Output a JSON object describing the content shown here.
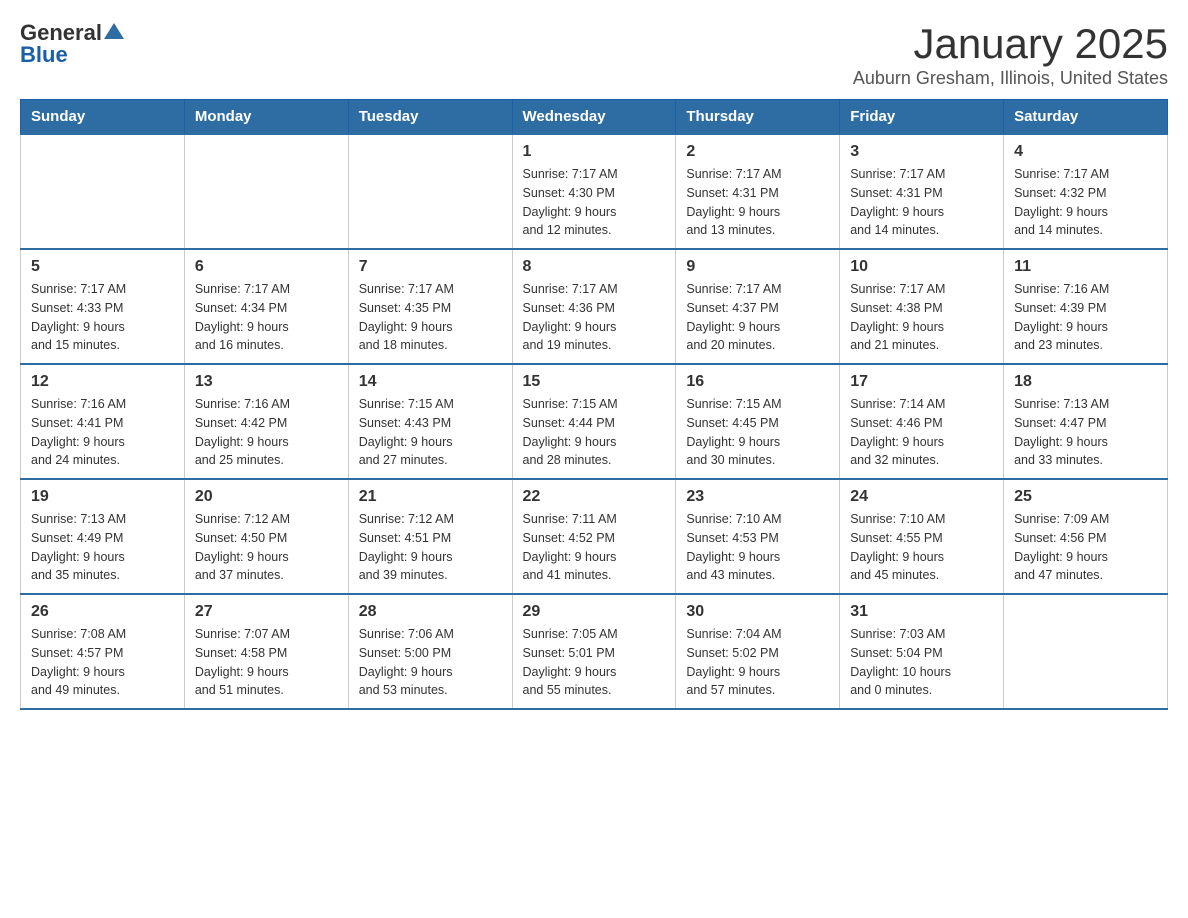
{
  "header": {
    "logo_general": "General",
    "logo_blue": "Blue",
    "month_title": "January 2025",
    "location": "Auburn Gresham, Illinois, United States"
  },
  "days_of_week": [
    "Sunday",
    "Monday",
    "Tuesday",
    "Wednesday",
    "Thursday",
    "Friday",
    "Saturday"
  ],
  "weeks": [
    [
      {
        "day": "",
        "info": ""
      },
      {
        "day": "",
        "info": ""
      },
      {
        "day": "",
        "info": ""
      },
      {
        "day": "1",
        "info": "Sunrise: 7:17 AM\nSunset: 4:30 PM\nDaylight: 9 hours\nand 12 minutes."
      },
      {
        "day": "2",
        "info": "Sunrise: 7:17 AM\nSunset: 4:31 PM\nDaylight: 9 hours\nand 13 minutes."
      },
      {
        "day": "3",
        "info": "Sunrise: 7:17 AM\nSunset: 4:31 PM\nDaylight: 9 hours\nand 14 minutes."
      },
      {
        "day": "4",
        "info": "Sunrise: 7:17 AM\nSunset: 4:32 PM\nDaylight: 9 hours\nand 14 minutes."
      }
    ],
    [
      {
        "day": "5",
        "info": "Sunrise: 7:17 AM\nSunset: 4:33 PM\nDaylight: 9 hours\nand 15 minutes."
      },
      {
        "day": "6",
        "info": "Sunrise: 7:17 AM\nSunset: 4:34 PM\nDaylight: 9 hours\nand 16 minutes."
      },
      {
        "day": "7",
        "info": "Sunrise: 7:17 AM\nSunset: 4:35 PM\nDaylight: 9 hours\nand 18 minutes."
      },
      {
        "day": "8",
        "info": "Sunrise: 7:17 AM\nSunset: 4:36 PM\nDaylight: 9 hours\nand 19 minutes."
      },
      {
        "day": "9",
        "info": "Sunrise: 7:17 AM\nSunset: 4:37 PM\nDaylight: 9 hours\nand 20 minutes."
      },
      {
        "day": "10",
        "info": "Sunrise: 7:17 AM\nSunset: 4:38 PM\nDaylight: 9 hours\nand 21 minutes."
      },
      {
        "day": "11",
        "info": "Sunrise: 7:16 AM\nSunset: 4:39 PM\nDaylight: 9 hours\nand 23 minutes."
      }
    ],
    [
      {
        "day": "12",
        "info": "Sunrise: 7:16 AM\nSunset: 4:41 PM\nDaylight: 9 hours\nand 24 minutes."
      },
      {
        "day": "13",
        "info": "Sunrise: 7:16 AM\nSunset: 4:42 PM\nDaylight: 9 hours\nand 25 minutes."
      },
      {
        "day": "14",
        "info": "Sunrise: 7:15 AM\nSunset: 4:43 PM\nDaylight: 9 hours\nand 27 minutes."
      },
      {
        "day": "15",
        "info": "Sunrise: 7:15 AM\nSunset: 4:44 PM\nDaylight: 9 hours\nand 28 minutes."
      },
      {
        "day": "16",
        "info": "Sunrise: 7:15 AM\nSunset: 4:45 PM\nDaylight: 9 hours\nand 30 minutes."
      },
      {
        "day": "17",
        "info": "Sunrise: 7:14 AM\nSunset: 4:46 PM\nDaylight: 9 hours\nand 32 minutes."
      },
      {
        "day": "18",
        "info": "Sunrise: 7:13 AM\nSunset: 4:47 PM\nDaylight: 9 hours\nand 33 minutes."
      }
    ],
    [
      {
        "day": "19",
        "info": "Sunrise: 7:13 AM\nSunset: 4:49 PM\nDaylight: 9 hours\nand 35 minutes."
      },
      {
        "day": "20",
        "info": "Sunrise: 7:12 AM\nSunset: 4:50 PM\nDaylight: 9 hours\nand 37 minutes."
      },
      {
        "day": "21",
        "info": "Sunrise: 7:12 AM\nSunset: 4:51 PM\nDaylight: 9 hours\nand 39 minutes."
      },
      {
        "day": "22",
        "info": "Sunrise: 7:11 AM\nSunset: 4:52 PM\nDaylight: 9 hours\nand 41 minutes."
      },
      {
        "day": "23",
        "info": "Sunrise: 7:10 AM\nSunset: 4:53 PM\nDaylight: 9 hours\nand 43 minutes."
      },
      {
        "day": "24",
        "info": "Sunrise: 7:10 AM\nSunset: 4:55 PM\nDaylight: 9 hours\nand 45 minutes."
      },
      {
        "day": "25",
        "info": "Sunrise: 7:09 AM\nSunset: 4:56 PM\nDaylight: 9 hours\nand 47 minutes."
      }
    ],
    [
      {
        "day": "26",
        "info": "Sunrise: 7:08 AM\nSunset: 4:57 PM\nDaylight: 9 hours\nand 49 minutes."
      },
      {
        "day": "27",
        "info": "Sunrise: 7:07 AM\nSunset: 4:58 PM\nDaylight: 9 hours\nand 51 minutes."
      },
      {
        "day": "28",
        "info": "Sunrise: 7:06 AM\nSunset: 5:00 PM\nDaylight: 9 hours\nand 53 minutes."
      },
      {
        "day": "29",
        "info": "Sunrise: 7:05 AM\nSunset: 5:01 PM\nDaylight: 9 hours\nand 55 minutes."
      },
      {
        "day": "30",
        "info": "Sunrise: 7:04 AM\nSunset: 5:02 PM\nDaylight: 9 hours\nand 57 minutes."
      },
      {
        "day": "31",
        "info": "Sunrise: 7:03 AM\nSunset: 5:04 PM\nDaylight: 10 hours\nand 0 minutes."
      },
      {
        "day": "",
        "info": ""
      }
    ]
  ]
}
